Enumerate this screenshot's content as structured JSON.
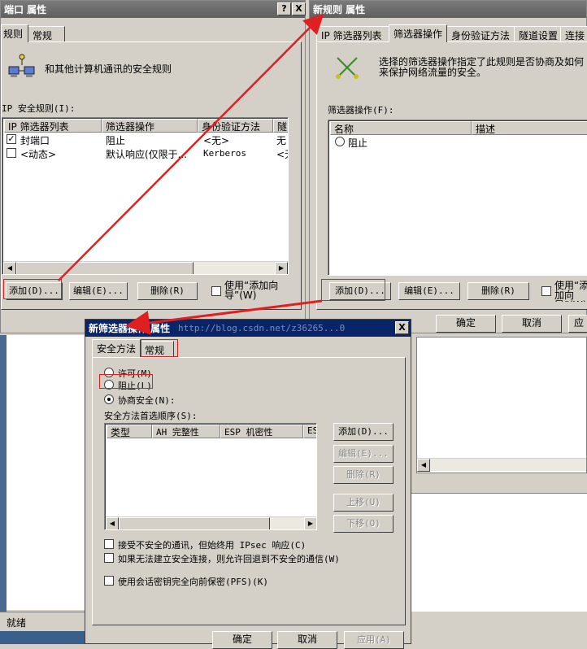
{
  "left_window": {
    "title": "端口 属性",
    "help_button": "?",
    "close_button": "X",
    "tabs": [
      "规则",
      "常规"
    ],
    "description": "和其他计算机通讯的安全规则",
    "rules_label": "IP 安全规则(I):",
    "columns": [
      "IP 筛选器列表",
      "筛选器操作",
      "身份验证方法",
      "隧"
    ],
    "rows": [
      {
        "checked": true,
        "name": "封端口",
        "action": "阻止",
        "auth": "<无>",
        "tunnel": "无"
      },
      {
        "checked": false,
        "name": "<动态>",
        "action": "默认响应(仅限于...",
        "auth": "Kerberos",
        "tunnel": "<无"
      }
    ],
    "add_button": "添加(D)...",
    "edit_button": "编辑(E)...",
    "delete_button": "删除(R)",
    "wizard_label": "使用“添加向导”(W)",
    "status": "就绪"
  },
  "right_window": {
    "title": "新规则 属性",
    "tabs": [
      "IP 筛选器列表",
      "筛选器操作",
      "身份验证方法",
      "隧道设置",
      "连接"
    ],
    "description": "选择的筛选器操作指定了此规则是否协商及如何来保护网络流量的安全。",
    "actions_label": "筛选器操作(F):",
    "columns": [
      "名称",
      "描述"
    ],
    "rows": [
      {
        "name": "阻止",
        "desc": ""
      }
    ],
    "add_button": "添加(D)...",
    "edit_button": "编辑(E)...",
    "delete_button": "删除(R)",
    "wizard_label": "使用“添加向导”(W)",
    "ok_button": "确定",
    "cancel_button": "取消",
    "apply_button": "应"
  },
  "dialog": {
    "title": "新筛选器操作 属性",
    "watermark": "http://blog.csdn.net/z36265...0",
    "close_button": "X",
    "tabs": [
      "安全方法",
      "常规"
    ],
    "radio_permit": "许可(M)",
    "radio_block": "阻止(L)",
    "radio_negotiate": "协商安全(N):",
    "methods_label": "安全方法首选顺序(S):",
    "columns": [
      "类型",
      "AH 完整性",
      "ESP 机密性",
      "ES"
    ],
    "add_button": "添加(D)...",
    "edit_button": "编辑(E)...",
    "delete_button": "删除(R)",
    "up_button": "上移(U)",
    "down_button": "下移(O)",
    "check_accept": "接受不安全的通讯，但始终用 IPsec 响应(C)",
    "check_fallback": "如果无法建立安全连接，则允许回退到不安全的通信(W)",
    "check_pfs": "使用会话密钥完全向前保密(PFS)(K)",
    "ok_button": "确定",
    "cancel_button": "取消",
    "apply_button": "应用(A)"
  },
  "colors": {
    "face": "#d4d0c8",
    "inactive_title": "#6e6e6e",
    "active_title": "#0a246a",
    "annotation_red": "#e02020"
  }
}
